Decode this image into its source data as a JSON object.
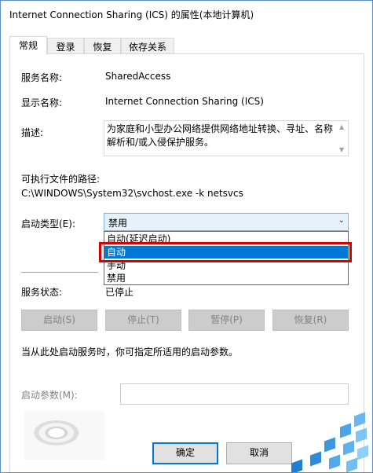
{
  "window": {
    "title": "Internet Connection Sharing (ICS) 的属性(本地计算机)"
  },
  "tabs": [
    {
      "label": "常规",
      "active": true
    },
    {
      "label": "登录",
      "active": false
    },
    {
      "label": "恢复",
      "active": false
    },
    {
      "label": "依存关系",
      "active": false
    }
  ],
  "general": {
    "service_name_label": "服务名称:",
    "service_name_value": "SharedAccess",
    "display_name_label": "显示名称:",
    "display_name_value": "Internet Connection Sharing (ICS)",
    "description_label": "描述:",
    "description_value": "为家庭和小型办公网络提供网络地址转换、寻址、名称解析和/或入侵保护服务。",
    "exe_path_label": "可执行文件的路径:",
    "exe_path_value": "C:\\WINDOWS\\System32\\svchost.exe -k netsvcs",
    "startup_type_label": "启动类型(E):",
    "startup_type_value": "禁用",
    "startup_options": [
      "自动(延迟启动)",
      "自动",
      "手动",
      "禁用"
    ],
    "startup_selected_option": "自动",
    "service_status_label": "服务状态:",
    "service_status_value": "已停止",
    "buttons": {
      "start": "启动(S)",
      "stop": "停止(T)",
      "pause": "暂停(P)",
      "resume": "恢复(R)"
    },
    "hint": "当从此处启动服务时，你可指定所适用的启动参数。",
    "start_params_label": "启动参数(M):",
    "start_params_value": ""
  },
  "footer": {
    "ok": "确定",
    "cancel": "取消"
  },
  "colors": {
    "accent": "#0078d7",
    "highlight_box": "#d60000",
    "window_border": "#5b8fc9"
  },
  "icons": {
    "dropdown_arrow": "chevron-down-icon",
    "scroll_up": "chevron-up-icon",
    "scroll_down": "chevron-down-icon"
  }
}
